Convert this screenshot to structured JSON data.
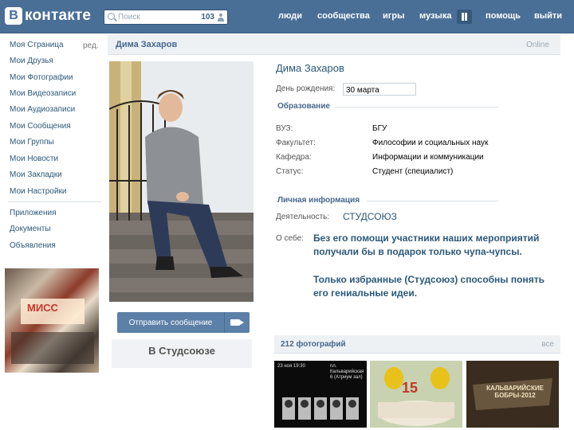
{
  "header": {
    "logo_letter": "В",
    "logo_text": "контакте",
    "search": {
      "placeholder": "Поиск",
      "count": "103"
    },
    "nav": [
      "люди",
      "сообщества",
      "игры",
      "музыка",
      "помощь",
      "выйти"
    ]
  },
  "sidebar": {
    "edit_label": "ред.",
    "items": [
      "Моя Страница",
      "Мои Друзья",
      "Мои Фотографии",
      "Мои Видеозаписи",
      "Мои Аудиозаписи",
      "Мои Сообщения",
      "Мои Группы",
      "Мои Новости",
      "Мои Закладки",
      "Мои Настройки"
    ],
    "extra": [
      "Приложения",
      "Документы",
      "Объявления"
    ],
    "ad_text": "МИСС"
  },
  "profile": {
    "bar_name": "Дима Захаров",
    "online_status": "Online",
    "name": "Дима Захаров",
    "birthday_label": "День рождения:",
    "birthday_value": "30 марта",
    "education_title": "Образование",
    "education": [
      {
        "label": "ВУЗ:",
        "value": "БГУ"
      },
      {
        "label": "Факультет:",
        "value": "Философии и социальных наук"
      },
      {
        "label": "Кафедра:",
        "value": "Информации и коммуникации"
      },
      {
        "label": "Статус:",
        "value": "Студент (специалист)"
      }
    ],
    "personal_title": "Личная информация",
    "activity_label": "Деятельность:",
    "activity_value": "СТУДСОЮЗ",
    "about_label": "О себе:",
    "about_p1": "Без его помощи участники наших мероприятий получали бы в подарок только чупа-чупсы.",
    "about_p2": "Только избранные (Студсоюз) способны понять его гениальные идеи.",
    "send_message": "Отправить сообщение",
    "group_label": "В Студсоюзе"
  },
  "photos": {
    "title": "212 фотографий",
    "all_label": "все",
    "thumb1_caption_a": "23 ноя 19:30",
    "thumb1_caption_b": "пл. Кальварийская 6 (Атриум зал)",
    "thumb2_number": "15",
    "thumb3_caption": "КАЛЬВАРИЙСКИЕ БОБРЫ-2012"
  }
}
